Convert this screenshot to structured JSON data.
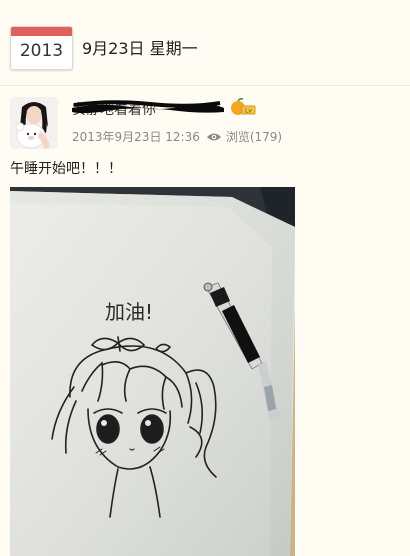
{
  "header": {
    "calendar_year": "2013",
    "date_label": "9月23日  星期一"
  },
  "post": {
    "author_name": "安静地看着你",
    "timestamp": "2013年9月23日 12:36",
    "views_label": "浏览(179)",
    "text": "午睡开始吧！！！",
    "image": {
      "handwritten_text": "加油!",
      "description_icon": "anime-drawing-with-pen"
    }
  },
  "icons": {
    "badge": "vip-fruit-badge-icon",
    "views": "eye-icon"
  },
  "colors": {
    "calendar_accent": "#e0605c",
    "background": "#fffdf3",
    "meta_text": "#888888"
  }
}
